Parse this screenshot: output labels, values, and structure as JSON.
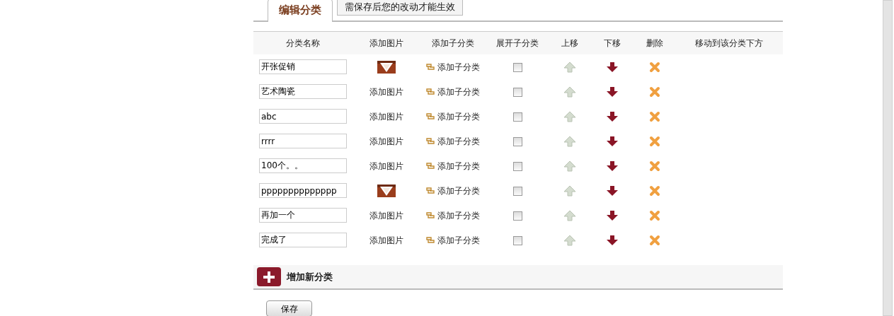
{
  "tabs": [
    {
      "label": "编辑分类",
      "selected": true
    },
    {
      "label": "需保存后您的改动才能生效",
      "selected": false
    }
  ],
  "table": {
    "columns": [
      "分类名称",
      "添加图片",
      "添加子分类",
      "展开子分类",
      "上移",
      "下移",
      "删除",
      "移动到该分类下方"
    ],
    "rows": [
      {
        "name": "开张促销",
        "add_child": "添加子分类",
        "expanded": false
      },
      {
        "name": "艺术陶瓷",
        "image": {
          "kind": "link",
          "label": "添加图片"
        },
        "add_child": "添加子分类",
        "expanded": false
      },
      {
        "name": "abc",
        "image": {
          "kind": "link",
          "label": "添加图片"
        },
        "add_child": "添加子分类",
        "expanded": false
      },
      {
        "name": "rrrr",
        "image": {
          "kind": "link",
          "label": "添加图片"
        },
        "add_child": "添加子分类",
        "expanded": false
      },
      {
        "name": "100个。。",
        "image": {
          "kind": "link",
          "label": "添加图片"
        },
        "add_child": "添加子分类",
        "expanded": false
      },
      {
        "name": "pppppppppppppp",
        "add_child": "添加子分类",
        "expanded": false
      },
      {
        "name": "再加一个",
        "image": {
          "kind": "link",
          "label": "添加图片"
        },
        "add_child": "添加子分类",
        "expanded": false
      },
      {
        "name": "完成了",
        "image": {
          "kind": "link",
          "label": "添加图片"
        },
        "add_child": "添加子分类",
        "expanded": false
      }
    ]
  },
  "add_category": "增加新分类",
  "save_button": "保存"
}
